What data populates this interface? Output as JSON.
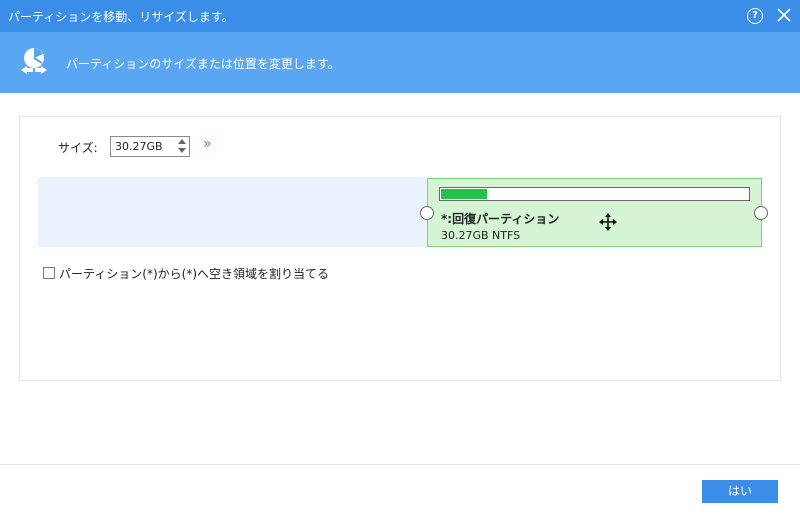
{
  "window": {
    "title": "パーティションを移動、リサイズします。",
    "help_glyph": "?"
  },
  "header": {
    "description": "パーティションのサイズまたは位置を変更します。"
  },
  "size": {
    "label": "サイズ:",
    "value": "30.27GB",
    "advanced_glyph": "»"
  },
  "partition": {
    "name": "*:回復パーティション",
    "info": "30.27GB NTFS",
    "used_fraction": 0.15
  },
  "option": {
    "label": "パーティション(*)から(*)へ空き領域を割り当てる",
    "checked": false
  },
  "footer": {
    "ok_label": "はい"
  },
  "colors": {
    "titlebar": "#3b8ee8",
    "header": "#5aa6f2",
    "partition_fill": "#d4f4d4",
    "usage_fill": "#22c24a",
    "unallocated": "#eaf3fd"
  },
  "icons": [
    "app-logo-icon",
    "help-icon",
    "close-icon",
    "spin-up-icon",
    "spin-down-icon",
    "advanced-chevron-icon",
    "move-cursor-icon"
  ]
}
